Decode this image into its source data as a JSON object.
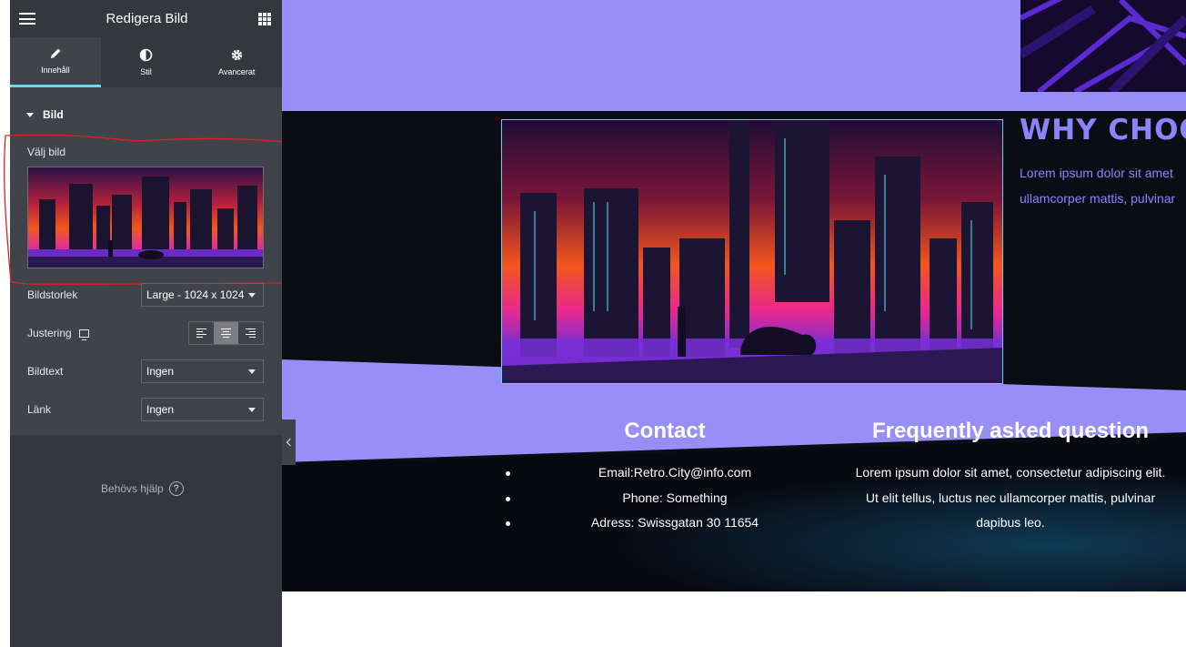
{
  "panel": {
    "title": "Redigera Bild",
    "tabs": [
      {
        "label": "Innehåll",
        "icon": "pencil-icon",
        "active": true
      },
      {
        "label": "Stil",
        "icon": "contrast-icon",
        "active": false
      },
      {
        "label": "Avancerat",
        "icon": "gear-icon",
        "active": false
      }
    ],
    "section_title": "Bild",
    "choose_image_label": "Välj bild",
    "image_size": {
      "label": "Bildstorlek",
      "value": "Large - 1024 x 1024"
    },
    "alignment": {
      "label": "Justering",
      "options": [
        "left",
        "center",
        "right"
      ],
      "selected": "center"
    },
    "caption": {
      "label": "Bildtext",
      "value": "Ingen"
    },
    "link": {
      "label": "Länk",
      "value": "Ingen"
    },
    "help": "Behövs hjälp",
    "colors": {
      "accent": "#71d7f7",
      "panel_bg": "#404349",
      "header_bg": "#34383c",
      "highlight": "#e02020"
    }
  },
  "preview": {
    "why_title": "WHY CHOOS",
    "why_text": [
      "Lorem ipsum dolor sit amet",
      "ullamcorper mattis, pulvinar"
    ],
    "contact": {
      "title": "Contact",
      "items": [
        "Email:Retro.City@info.com",
        "Phone: Something",
        "Adress: Swissgatan 30 11654"
      ]
    },
    "faq": {
      "title": "Frequently asked question",
      "text": "Lorem ipsum dolor sit amet, consectetur adipiscing elit. Ut elit tellus, luctus nec ullamcorper mattis, pulvinar dapibus leo."
    },
    "colors": {
      "purple": "#978ef8",
      "dark": "#0b0c14",
      "title_purple": "#8a84ff"
    }
  }
}
